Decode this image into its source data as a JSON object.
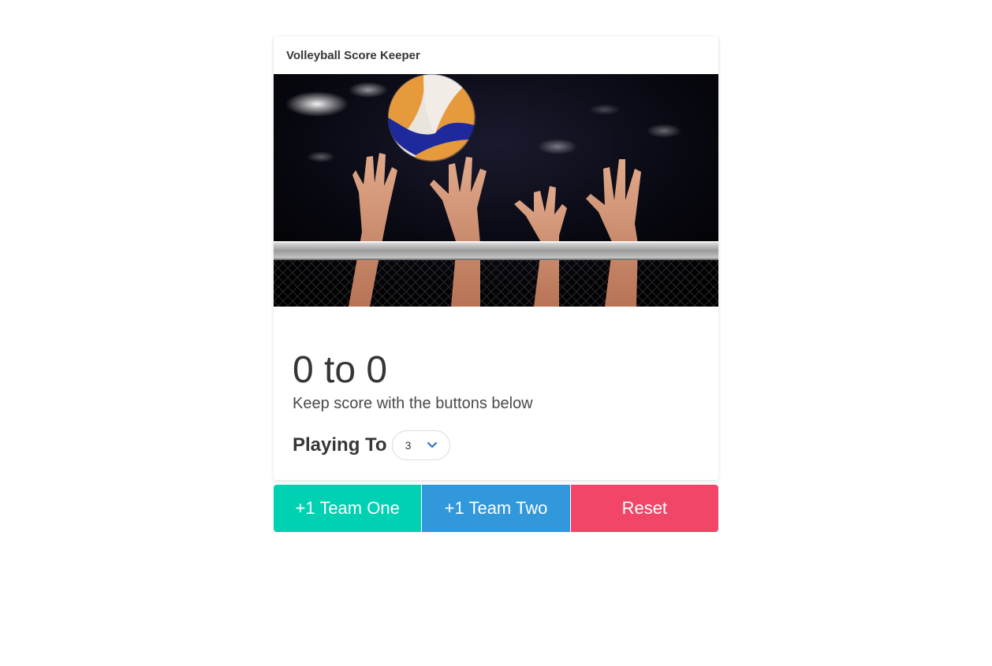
{
  "header": {
    "title": "Volleyball Score Keeper"
  },
  "image": {
    "icon": "volleyball-photo"
  },
  "score": {
    "text": "0 to 0",
    "team_one": 0,
    "team_two": 0
  },
  "subtitle": "Keep score with the buttons below",
  "playing_to": {
    "label": "Playing To",
    "selected": "3"
  },
  "buttons": {
    "team_one": "+1 Team One",
    "team_two": "+1 Team Two",
    "reset": "Reset"
  },
  "colors": {
    "team_one": "#00d1b2",
    "team_two": "#3298dc",
    "reset": "#f14668",
    "select_arrow": "#3273dc"
  }
}
